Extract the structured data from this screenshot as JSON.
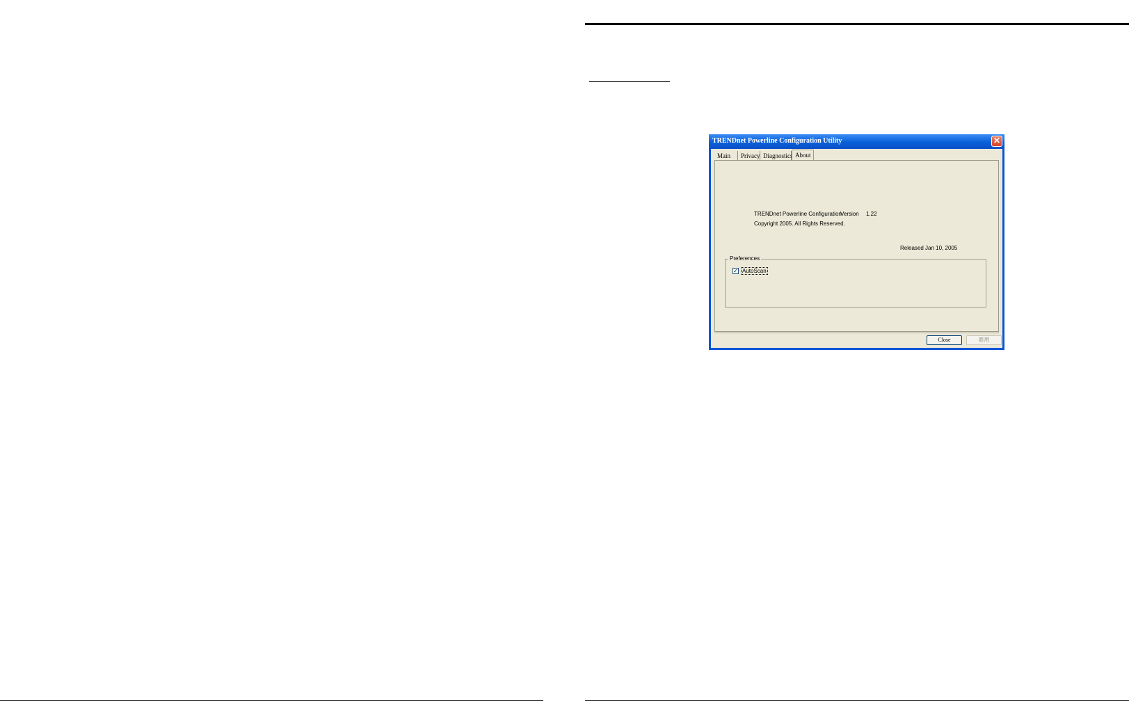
{
  "window": {
    "title": "TRENDnet Powerline Configuration Utility",
    "close_glyph": "✕"
  },
  "tabs": [
    {
      "label": "Main"
    },
    {
      "label": "Privacy"
    },
    {
      "label": "Diagnostics"
    },
    {
      "label": "About",
      "selected": true
    }
  ],
  "about": {
    "product_name": "TRENDnet Powerline Configuration",
    "version_label": "Version",
    "version_value": "1.22",
    "copyright": "Copyright 2005. All Rights Reserved.",
    "released": "Released Jan 10, 2005"
  },
  "preferences": {
    "group_label": "Preferences",
    "autoscan_label": "AutoScan",
    "autoscan_checked": true,
    "check_glyph": "✓"
  },
  "buttons": {
    "close_label": "Close",
    "apply_label": "套用",
    "apply_enabled": false
  },
  "colors": {
    "titlebar": "#0a5fd8",
    "dialog_bg": "#ece9d8",
    "close_button": "#d7442a"
  },
  "icons": {
    "close": "close-icon",
    "checkbox": "checkmark-icon"
  }
}
